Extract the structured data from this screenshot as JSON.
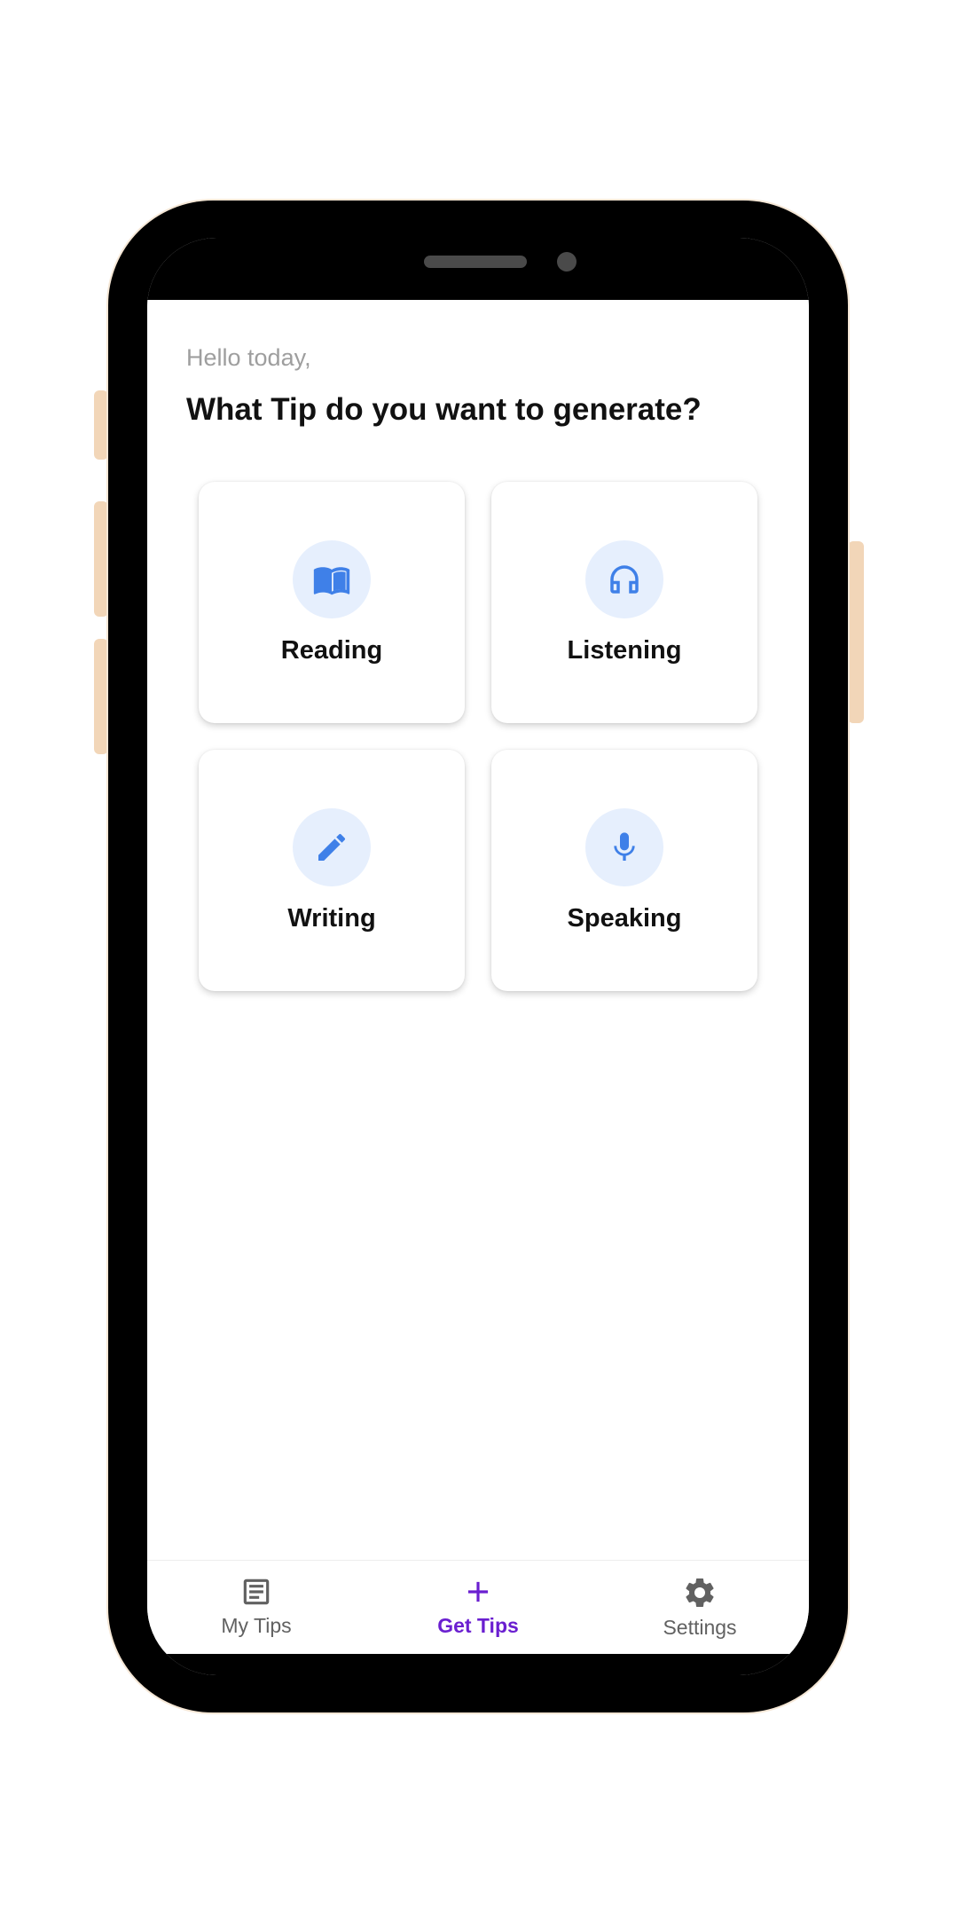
{
  "header": {
    "greeting": "Hello today,",
    "title": "What Tip do you want to generate?"
  },
  "categories": [
    {
      "label": "Reading",
      "icon": "book-open-icon"
    },
    {
      "label": "Listening",
      "icon": "headphones-icon"
    },
    {
      "label": "Writing",
      "icon": "pencil-icon"
    },
    {
      "label": "Speaking",
      "icon": "microphone-icon"
    }
  ],
  "bottom_nav": {
    "items": [
      {
        "label": "My Tips",
        "icon": "list-document-icon",
        "active": false
      },
      {
        "label": "Get Tips",
        "icon": "plus-icon",
        "active": true
      },
      {
        "label": "Settings",
        "icon": "gear-icon",
        "active": false
      }
    ]
  },
  "colors": {
    "accent": "#6a1fd0",
    "icon_blue": "#3f80e8",
    "icon_bg": "#e6effd",
    "nav_inactive": "#616161"
  }
}
